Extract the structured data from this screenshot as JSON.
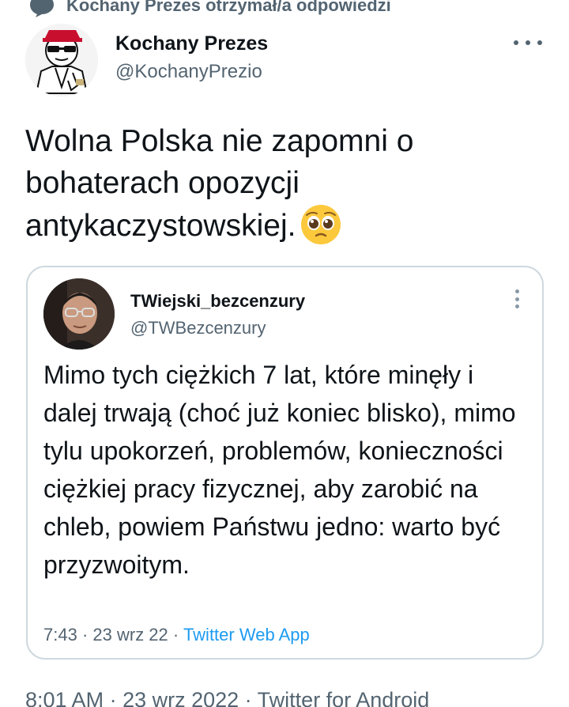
{
  "context": {
    "text": "Kochany Prezes otrzymał/a odpowiedzi",
    "icon": "speech-bubble-icon"
  },
  "author": {
    "display_name": "Kochany Prezes",
    "handle": "@KochanyPrezio",
    "more_icon": "more-horizontal-icon"
  },
  "tweet": {
    "text": "Wolna Polska nie zapomni o bohaterach opozycji antykaczystowskiej.",
    "emoji": "pleading-face-emoji"
  },
  "quoted": {
    "display_name": "TWiejski_bezcenzury",
    "handle": "@TWBezcenzury",
    "more_icon": "more-vertical-icon",
    "text": "Mimo tych ciężkich 7 lat, które minęły i dalej trwają (choć już koniec blisko), mimo tylu upokorzeń, problemów, konieczności ciężkiej pracy fizycznej, aby zarobić na chleb, powiem Państwu jedno: warto być przyzwoitym.",
    "time": "7:43",
    "separator": " · ",
    "date": "23 wrz 22",
    "source": "Twitter Web App"
  },
  "meta": {
    "time": "8:01 AM",
    "separator": " · ",
    "date": "23 wrz 2022",
    "source": "Twitter for Android"
  },
  "colors": {
    "text_primary": "#0f1419",
    "text_secondary": "#536471",
    "link": "#1d9bf0",
    "border": "#cfd9de"
  }
}
